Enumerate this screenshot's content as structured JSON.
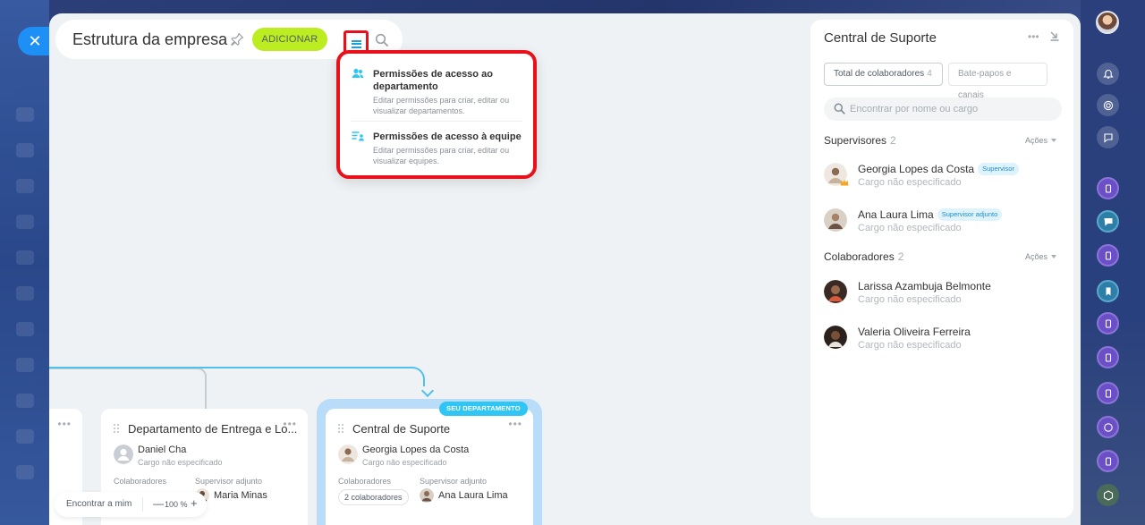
{
  "header": {
    "title": "Estrutura da empresa",
    "add_label": "ADICIONAR"
  },
  "close_label": "✕",
  "dropdown": {
    "items": [
      {
        "title": "Permissões de acesso ao departamento",
        "desc": "Editar permissões para criar, editar ou visualizar departamentos."
      },
      {
        "title": "Permissões de acesso à equipe",
        "desc": "Editar permissões para criar, editar ou visualizar equipes."
      }
    ]
  },
  "tree": {
    "left_dots": "•••",
    "entrega": {
      "title": "Departamento de Entrega e Lo...",
      "head_name": "Daniel Cha",
      "head_role": "Cargo não especificado",
      "label_employees": "Colaboradores",
      "label_deputy": "Supervisor adjunto",
      "deputy_name": "Maria Minas"
    },
    "central": {
      "badge": "SEU DEPARTAMENTO",
      "title": "Central de Suporte",
      "head_name": "Georgia Lopes da Costa",
      "head_role": "Cargo não especificado",
      "label_employees": "Colaboradores",
      "label_deputy": "Supervisor adjunto",
      "employees_count": "2 colaboradores",
      "deputy_name": "Ana Laura Lima"
    },
    "dots": "•••"
  },
  "zoom_bar": {
    "find_me": "Encontrar a mim",
    "minus": "—",
    "zoom": "100 %",
    "plus": "+"
  },
  "panel": {
    "title": "Central de Suporte",
    "dots": "•••",
    "tabs": [
      {
        "label": "Total de colaboradores",
        "count": "4"
      },
      {
        "label": "Bate-papos e canais"
      }
    ],
    "search_placeholder": "Encontrar por nome ou cargo",
    "supervisors": {
      "title": "Supervisores",
      "count": "2",
      "actions": "Ações",
      "people": [
        {
          "name": "Georgia Lopes da Costa",
          "badge": "Supervisor",
          "role": "Cargo não especificado"
        },
        {
          "name": "Ana Laura Lima",
          "badge": "Supervisor adjunto",
          "role": "Cargo não especificado"
        }
      ]
    },
    "employees": {
      "title": "Colaboradores",
      "count": "2",
      "actions": "Ações",
      "people": [
        {
          "name": "Larissa Azambuja Belmonte",
          "role": "Cargo não especificado"
        },
        {
          "name": "Valeria Oliveira Ferreira",
          "role": "Cargo não especificado"
        }
      ]
    }
  },
  "colors": {
    "accent_blue": "#1e90f5",
    "add_green": "#bbed21",
    "highlight_red": "#e8101b",
    "badge_cyan": "#2fc6f6"
  },
  "icons": {
    "close": "close-icon",
    "pin": "pin-icon",
    "menu": "menu-icon",
    "search": "search-icon",
    "bell": "bell-icon",
    "chat": "chat-icon"
  }
}
